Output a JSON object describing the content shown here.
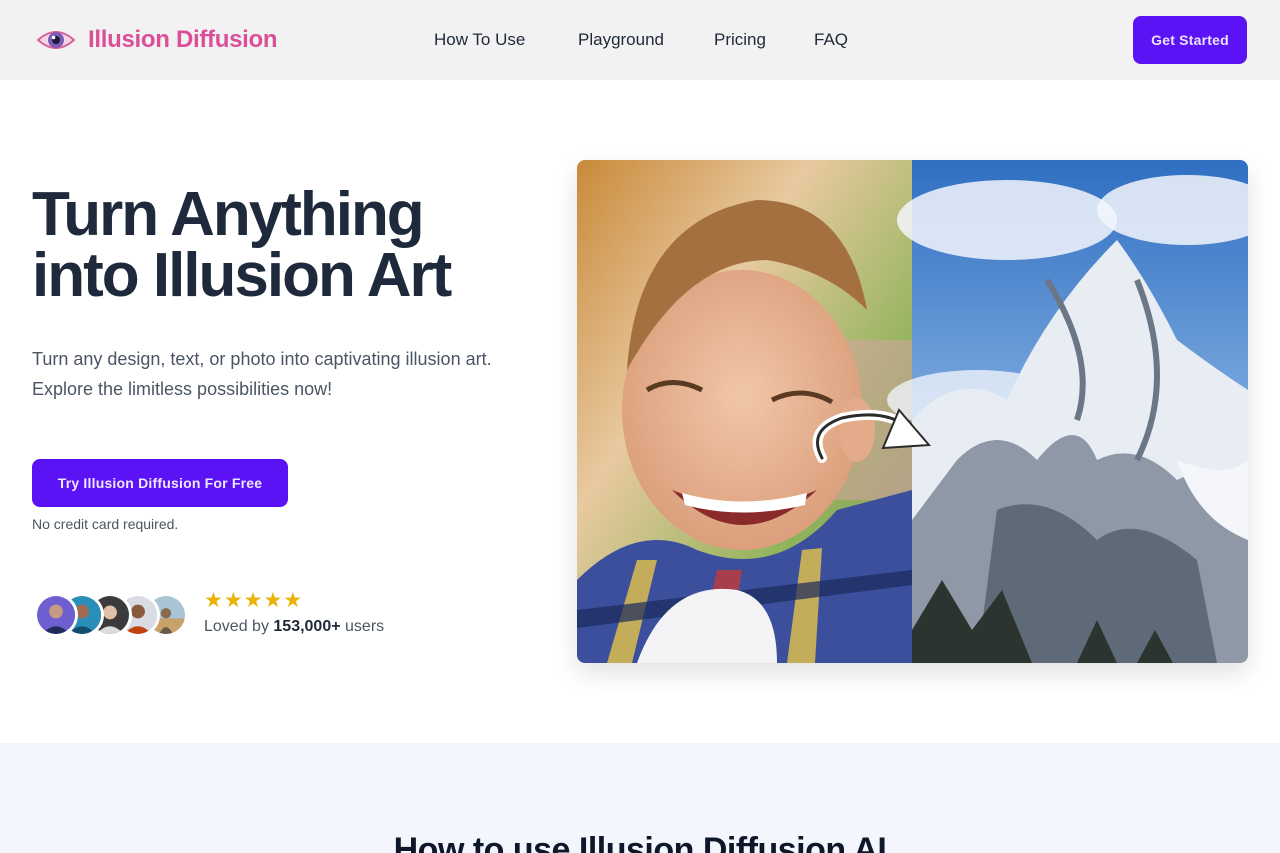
{
  "header": {
    "brand": "Illusion Diffusion",
    "nav": [
      "How To Use",
      "Playground",
      "Pricing",
      "FAQ"
    ],
    "cta_label": "Get Started"
  },
  "hero": {
    "title_line1": "Turn Anything",
    "title_line2": "into Illusion Art",
    "subtitle": "Turn any design, text, or photo into captivating illusion art. Explore the limitless possibilities now!",
    "cta_label": "Try Illusion Diffusion For Free",
    "note": "No credit card required.",
    "rating": 5,
    "loved_prefix": "Loved by",
    "loved_count": "153,000+",
    "loved_suffix": "users"
  },
  "section2": {
    "heading": "How to use Illusion Diffusion AI"
  },
  "colors": {
    "brand_pink": "#dc4f98",
    "primary": "#5b12f5",
    "star": "#eab308"
  },
  "icons": [
    "eye-logo-icon",
    "star-icon",
    "arrow-icon"
  ]
}
